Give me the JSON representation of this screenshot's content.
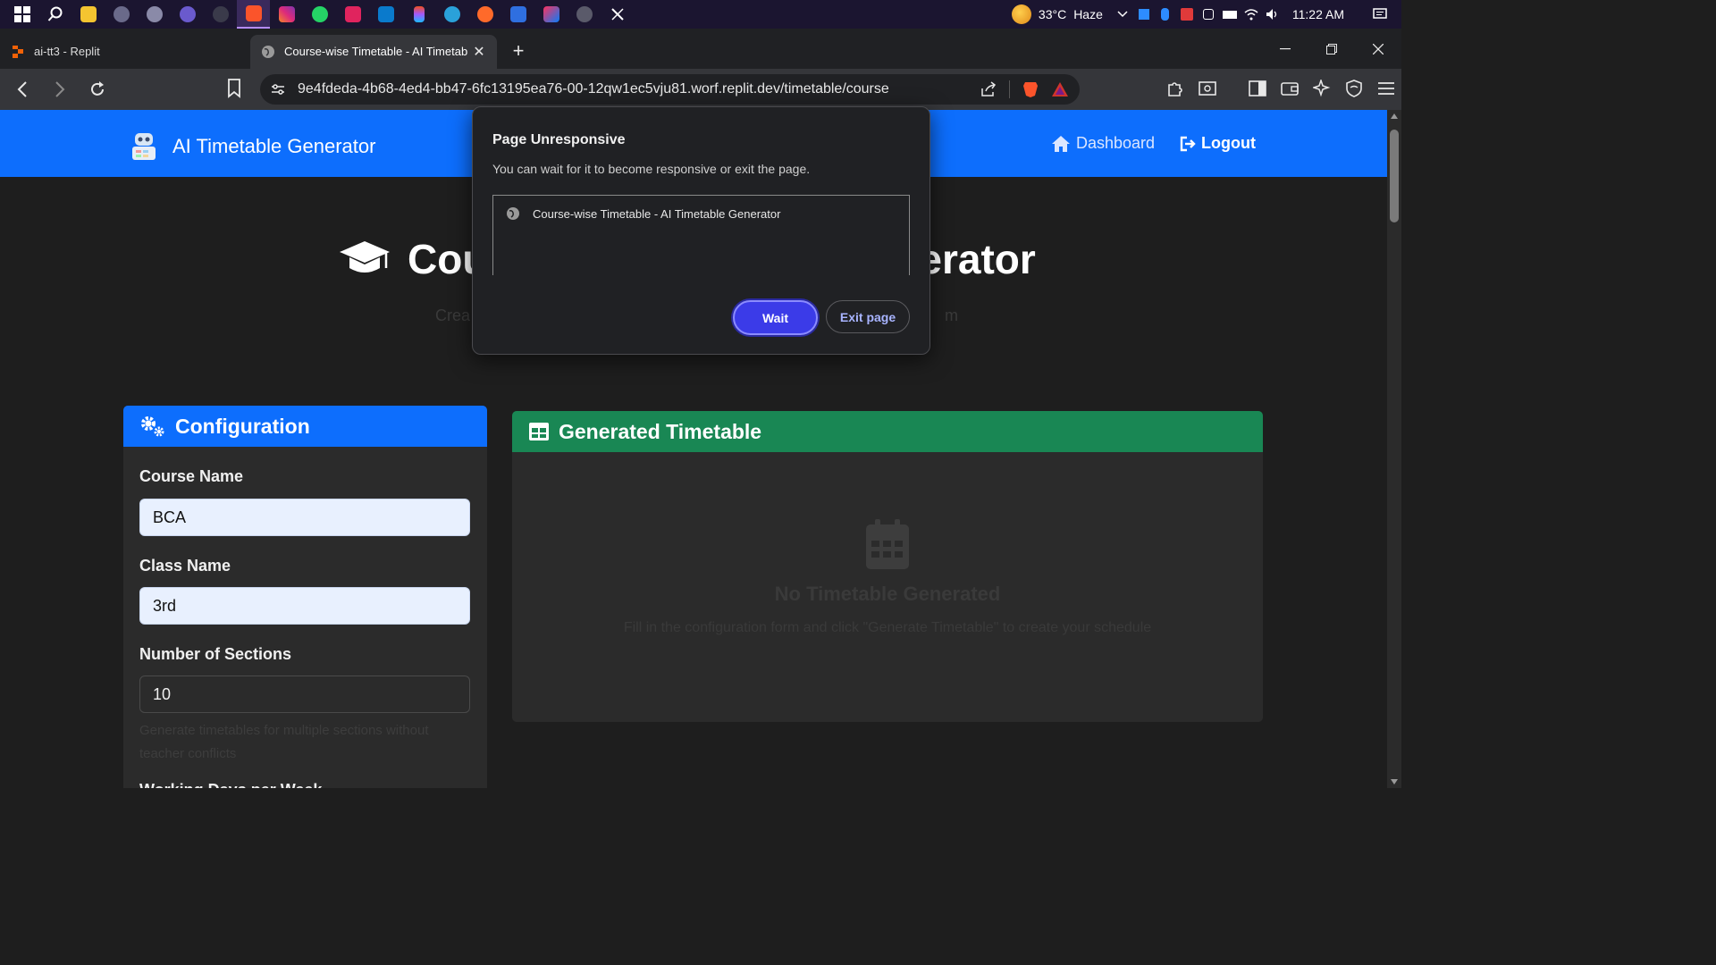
{
  "taskbar": {
    "apps": [
      "start",
      "search",
      "file-explorer",
      "app-1",
      "app-2",
      "app-3",
      "app-4",
      "brave",
      "instagram",
      "whatsapp",
      "app-5",
      "vscode",
      "figma",
      "telegram",
      "app-6",
      "app-7",
      "intellij",
      "app-8",
      "x"
    ],
    "weather": {
      "temperature": "33°C",
      "condition": "Haze"
    },
    "time": "11:22 AM"
  },
  "browser": {
    "tabs": [
      {
        "label": "ai-tt3 - Replit",
        "active": false
      },
      {
        "label": "Course-wise Timetable - AI Timetab",
        "active": true
      }
    ],
    "url": "9e4fdeda-4b68-4ed4-bb47-6fc13195ea76-00-12qw1ec5vju81.worf.replit.dev/timetable/course"
  },
  "app": {
    "brand": "AI Timetable Generator",
    "nav": {
      "dashboard": "Dashboard",
      "logout": "Logout"
    },
    "hero": {
      "title_left": "Cou",
      "title_right": "erator",
      "subtitle_left": "Crea",
      "subtitle_right": "m"
    },
    "config": {
      "title": "Configuration",
      "course_name_label": "Course Name",
      "course_name_value": "BCA",
      "class_name_label": "Class Name",
      "class_name_value": "3rd",
      "sections_label": "Number of Sections",
      "sections_value": "10",
      "sections_help": "Generate timetables for multiple sections without teacher conflicts",
      "next_label": "Working Days per Week"
    },
    "generated": {
      "title": "Generated Timetable",
      "empty_title": "No Timetable Generated",
      "empty_text": "Fill in the configuration form and click \"Generate Timetable\" to create your schedule"
    }
  },
  "dialog": {
    "title": "Page Unresponsive",
    "message": "You can wait for it to become responsive or exit the page.",
    "page_item": "Course-wise Timetable - AI Timetable Generator",
    "wait_label": "Wait",
    "exit_label": "Exit page"
  }
}
